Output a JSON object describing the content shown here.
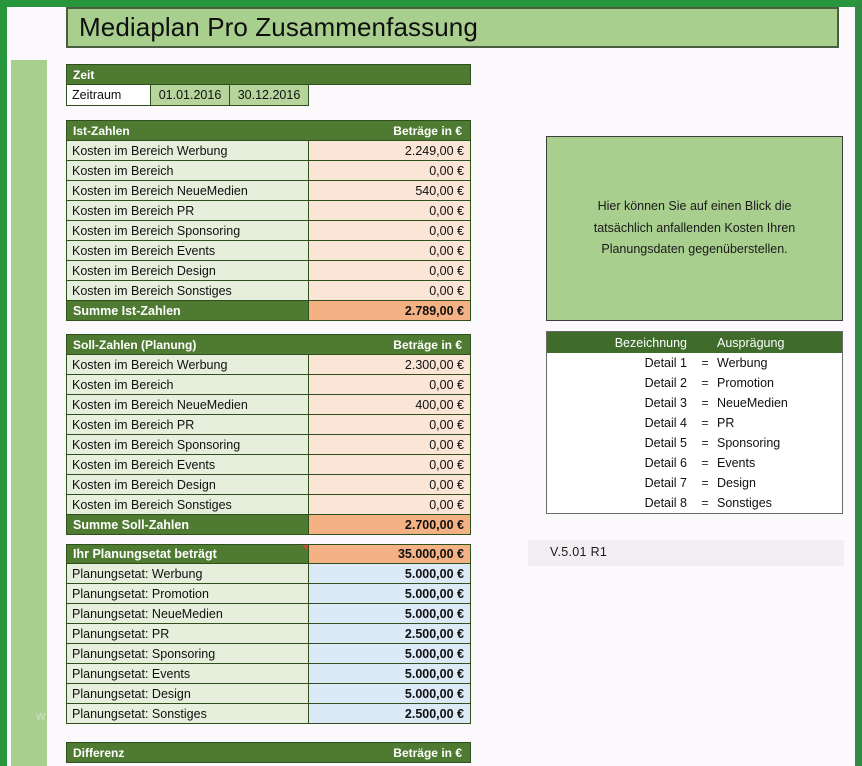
{
  "title": "Mediaplan Pro Zusammenfassung",
  "zeit": {
    "header": "Zeit",
    "row_label": "Zeitraum",
    "date_from": "01.01.2016",
    "date_to": "30.12.2016"
  },
  "ist": {
    "header": "Ist-Zahlen",
    "amount_header": "Beträge in €",
    "rows": [
      {
        "label": "Kosten im Bereich Werbung",
        "value": "2.249,00 €"
      },
      {
        "label": "Kosten im Bereich",
        "value": "0,00 €"
      },
      {
        "label": "Kosten im Bereich NeueMedien",
        "value": "540,00 €"
      },
      {
        "label": "Kosten im Bereich PR",
        "value": "0,00 €"
      },
      {
        "label": "Kosten im Bereich Sponsoring",
        "value": "0,00 €"
      },
      {
        "label": "Kosten im Bereich Events",
        "value": "0,00 €"
      },
      {
        "label": "Kosten im Bereich Design",
        "value": "0,00 €"
      },
      {
        "label": "Kosten im Bereich Sonstiges",
        "value": "0,00 €"
      }
    ],
    "sum_label": "Summe Ist-Zahlen",
    "sum_value": "2.789,00 €"
  },
  "soll": {
    "header": "Soll-Zahlen (Planung)",
    "amount_header": "Beträge in €",
    "rows": [
      {
        "label": "Kosten im Bereich Werbung",
        "value": "2.300,00 €"
      },
      {
        "label": "Kosten im Bereich",
        "value": "0,00 €"
      },
      {
        "label": "Kosten im Bereich NeueMedien",
        "value": "400,00 €"
      },
      {
        "label": "Kosten im Bereich PR",
        "value": "0,00 €"
      },
      {
        "label": "Kosten im Bereich Sponsoring",
        "value": "0,00 €"
      },
      {
        "label": "Kosten im Bereich Events",
        "value": "0,00 €"
      },
      {
        "label": "Kosten im Bereich Design",
        "value": "0,00 €"
      },
      {
        "label": "Kosten im Bereich Sonstiges",
        "value": "0,00 €"
      }
    ],
    "sum_label": "Summe Soll-Zahlen",
    "sum_value": "2.700,00 €"
  },
  "etat": {
    "header": "Ihr Planungsetat beträgt",
    "total_value": "35.000,00 €",
    "rows": [
      {
        "label": "Planungsetat: Werbung",
        "value": "5.000,00 €"
      },
      {
        "label": "Planungsetat: Promotion",
        "value": "5.000,00 €"
      },
      {
        "label": "Planungsetat: NeueMedien",
        "value": "5.000,00 €"
      },
      {
        "label": "Planungsetat: PR",
        "value": "2.500,00 €"
      },
      {
        "label": "Planungsetat: Sponsoring",
        "value": "5.000,00 €"
      },
      {
        "label": "Planungsetat: Events",
        "value": "5.000,00 €"
      },
      {
        "label": "Planungsetat: Design",
        "value": "5.000,00 €"
      },
      {
        "label": "Planungsetat: Sonstiges",
        "value": "2.500,00 €"
      }
    ]
  },
  "differenz": {
    "header": "Differenz",
    "amount_header": "Beträge in €"
  },
  "info_box": {
    "text": "Hier können Sie auf einen Blick die tatsächlich anfallenden Kosten Ihren Planungsdaten gegenüberstellen."
  },
  "legend": {
    "col1": "Bezeichnung",
    "col2": "Ausprägung",
    "rows": [
      {
        "name": "Detail 1",
        "eq": "=",
        "value": "Werbung"
      },
      {
        "name": "Detail 2",
        "eq": "=",
        "value": "Promotion"
      },
      {
        "name": "Detail 3",
        "eq": "=",
        "value": "NeueMedien"
      },
      {
        "name": "Detail 4",
        "eq": "=",
        "value": "PR"
      },
      {
        "name": "Detail 5",
        "eq": "=",
        "value": "Sponsoring"
      },
      {
        "name": "Detail 6",
        "eq": "=",
        "value": "Events"
      },
      {
        "name": "Detail 7",
        "eq": "=",
        "value": "Design"
      },
      {
        "name": "Detail 8",
        "eq": "=",
        "value": "Sonstiges"
      }
    ]
  },
  "version": "V.5.01 R1",
  "watermark": "w",
  "colors": {
    "frame_green": "#28963c",
    "header_green": "#4e7b31",
    "label_green": "#e6efdc",
    "value_peach": "#fbe5d6",
    "sum_orange": "#f4b183",
    "budget_blue": "#dce9f7",
    "panel_green": "#a9cf8f",
    "comment_red": "#d04a3a"
  }
}
